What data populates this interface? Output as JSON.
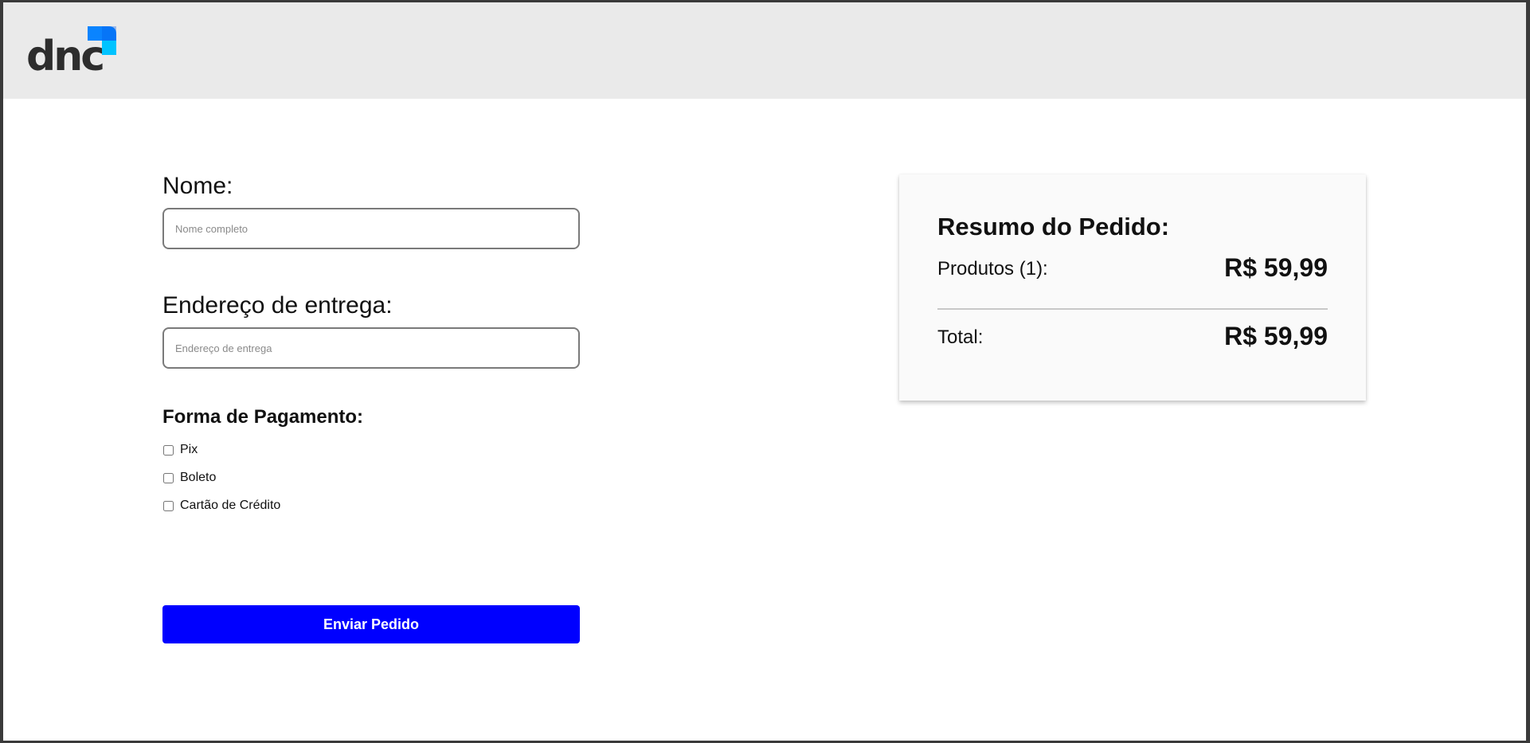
{
  "brand": {
    "logo_text": "dnc",
    "logo_colors": [
      "#0a84ff",
      "#00c3ff",
      "#0059e8"
    ]
  },
  "form": {
    "name_label": "Nome:",
    "name_placeholder": "Nome completo",
    "name_value": "",
    "address_label": "Endereço de entrega:",
    "address_placeholder": "Endereço de entrega",
    "address_value": "",
    "payment_title": "Forma de Pagamento:",
    "payment_options": [
      {
        "label": "Pix",
        "checked": false
      },
      {
        "label": "Boleto",
        "checked": false
      },
      {
        "label": "Cartão de Crédito",
        "checked": false
      }
    ],
    "submit_label": "Enviar Pedido",
    "submit_color": "#0000ff"
  },
  "summary": {
    "title": "Resumo do Pedido:",
    "products_label": "Produtos (1):",
    "products_value": "R$ 59,99",
    "total_label": "Total:",
    "total_value": "R$ 59,99"
  }
}
